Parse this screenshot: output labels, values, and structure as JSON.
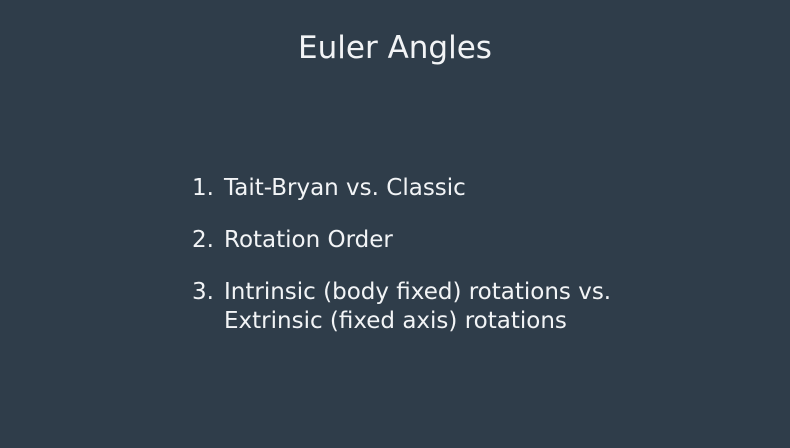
{
  "slide": {
    "title": "Euler Angles",
    "items": [
      {
        "number": "1.",
        "lines": [
          "Tait-Bryan vs. Classic"
        ]
      },
      {
        "number": "2.",
        "lines": [
          "Rotation Order"
        ]
      },
      {
        "number": "3.",
        "lines": [
          "Intrinsic (body fixed) rotations vs.",
          "Extrinsic (fixed axis) rotations"
        ]
      }
    ],
    "colors": {
      "background": "#2f3d4a",
      "text": "#f2f4f6"
    }
  }
}
